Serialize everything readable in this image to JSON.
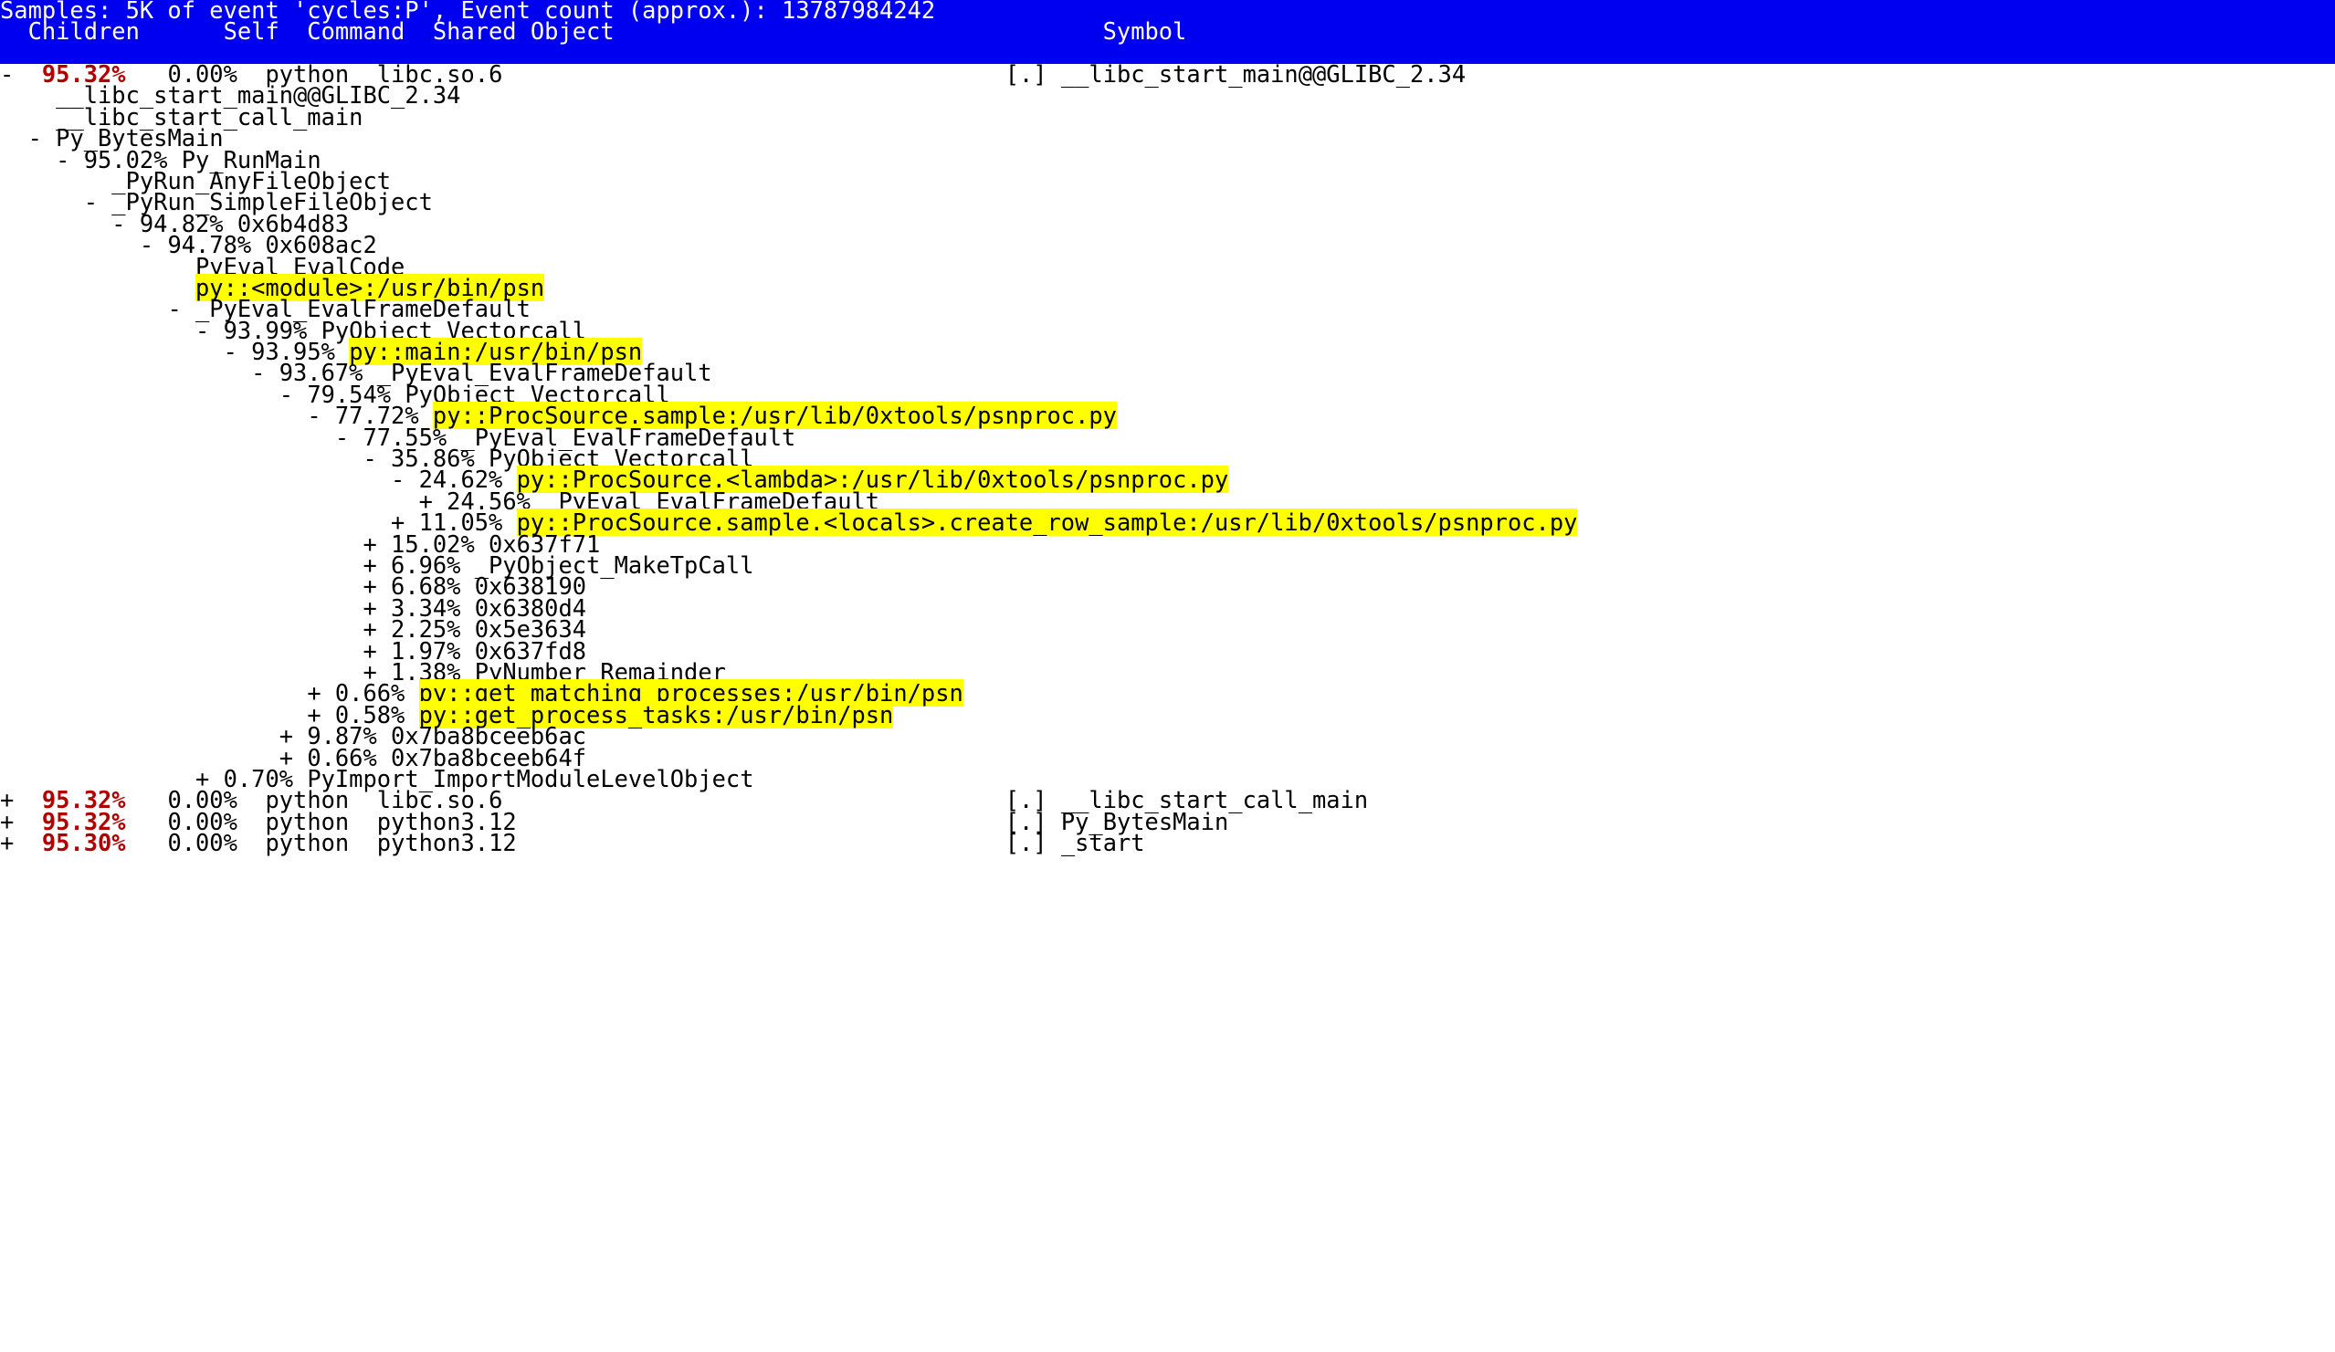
{
  "window": {
    "app": "perf report",
    "colors": {
      "banner_bg": "#0000f0",
      "banner_fg": "#ffffff",
      "percent_children": "#b00000",
      "highlight_bg": "#ffff00",
      "text": "#000000",
      "background": "#ffffff"
    }
  },
  "banner": {
    "samples_line": "Samples: 5K of event 'cycles:P', Event count (approx.): 13787984242",
    "columns": {
      "children": "Children",
      "self": "Self",
      "command": "Command",
      "shared_object": "Shared Object",
      "symbol": "Symbol"
    },
    "columns_line": "  Children      Self  Command  Shared Object                                   Symbol"
  },
  "rows": [
    {
      "type": "entry",
      "marker": "-",
      "children": "95.32%",
      "self": "0.00%",
      "command": "python",
      "dso": "libc.so.6",
      "symbol_prefix": "[.] ",
      "symbol": "__libc_start_main@@GLIBC_2.34"
    },
    {
      "type": "call",
      "indent": 4,
      "marker": "",
      "pct": "",
      "label": "__libc_start_main@@GLIBC_2.34",
      "highlight": false
    },
    {
      "type": "call",
      "indent": 4,
      "marker": "",
      "pct": "",
      "label": "__libc_start_call_main",
      "highlight": false
    },
    {
      "type": "call",
      "indent": 2,
      "marker": "-",
      "pct": "",
      "label": "Py_BytesMain",
      "highlight": false
    },
    {
      "type": "call",
      "indent": 4,
      "marker": "-",
      "pct": "95.02%",
      "label": "Py_RunMain",
      "highlight": false
    },
    {
      "type": "call",
      "indent": 8,
      "marker": "",
      "pct": "",
      "label": "_PyRun_AnyFileObject",
      "highlight": false
    },
    {
      "type": "call",
      "indent": 6,
      "marker": "-",
      "pct": "",
      "label": "_PyRun_SimpleFileObject",
      "highlight": false
    },
    {
      "type": "call",
      "indent": 8,
      "marker": "-",
      "pct": "94.82%",
      "label": "0x6b4d83",
      "highlight": false
    },
    {
      "type": "call",
      "indent": 10,
      "marker": "-",
      "pct": "94.78%",
      "label": "0x608ac2",
      "highlight": false
    },
    {
      "type": "call",
      "indent": 14,
      "marker": "",
      "pct": "",
      "label": "PyEval_EvalCode",
      "highlight": false
    },
    {
      "type": "call",
      "indent": 14,
      "marker": "",
      "pct": "",
      "label": "py::<module>:/usr/bin/psn",
      "highlight": true
    },
    {
      "type": "call",
      "indent": 12,
      "marker": "-",
      "pct": "",
      "label": "_PyEval_EvalFrameDefault",
      "highlight": false
    },
    {
      "type": "call",
      "indent": 14,
      "marker": "-",
      "pct": "93.99%",
      "label": "PyObject_Vectorcall",
      "highlight": false
    },
    {
      "type": "call",
      "indent": 16,
      "marker": "-",
      "pct": "93.95%",
      "label": "py::main:/usr/bin/psn",
      "highlight": true
    },
    {
      "type": "call",
      "indent": 18,
      "marker": "-",
      "pct": "93.67%",
      "label": "_PyEval_EvalFrameDefault",
      "highlight": false
    },
    {
      "type": "call",
      "indent": 20,
      "marker": "-",
      "pct": "79.54%",
      "label": "PyObject_Vectorcall",
      "highlight": false
    },
    {
      "type": "call",
      "indent": 22,
      "marker": "-",
      "pct": "77.72%",
      "label": "py::ProcSource.sample:/usr/lib/0xtools/psnproc.py",
      "highlight": true
    },
    {
      "type": "call",
      "indent": 24,
      "marker": "-",
      "pct": "77.55%",
      "label": "_PyEval_EvalFrameDefault",
      "highlight": false
    },
    {
      "type": "call",
      "indent": 26,
      "marker": "-",
      "pct": "35.86%",
      "label": "PyObject_Vectorcall",
      "highlight": false
    },
    {
      "type": "call",
      "indent": 28,
      "marker": "-",
      "pct": "24.62%",
      "label": "py::ProcSource.<lambda>:/usr/lib/0xtools/psnproc.py",
      "highlight": true
    },
    {
      "type": "call",
      "indent": 30,
      "marker": "+",
      "pct": "24.56%",
      "label": "_PyEval_EvalFrameDefault",
      "highlight": false
    },
    {
      "type": "call",
      "indent": 28,
      "marker": "+",
      "pct": "11.05%",
      "label": "py::ProcSource.sample.<locals>.create_row_sample:/usr/lib/0xtools/psnproc.py",
      "highlight": true
    },
    {
      "type": "call",
      "indent": 26,
      "marker": "+",
      "pct": "15.02%",
      "label": "0x637f71",
      "highlight": false
    },
    {
      "type": "call",
      "indent": 26,
      "marker": "+",
      "pct": "6.96%",
      "label": "_PyObject_MakeTpCall",
      "highlight": false
    },
    {
      "type": "call",
      "indent": 26,
      "marker": "+",
      "pct": "6.68%",
      "label": "0x638190",
      "highlight": false
    },
    {
      "type": "call",
      "indent": 26,
      "marker": "+",
      "pct": "3.34%",
      "label": "0x6380d4",
      "highlight": false
    },
    {
      "type": "call",
      "indent": 26,
      "marker": "+",
      "pct": "2.25%",
      "label": "0x5e3634",
      "highlight": false
    },
    {
      "type": "call",
      "indent": 26,
      "marker": "+",
      "pct": "1.97%",
      "label": "0x637fd8",
      "highlight": false
    },
    {
      "type": "call",
      "indent": 26,
      "marker": "+",
      "pct": "1.38%",
      "label": "PyNumber_Remainder",
      "highlight": false
    },
    {
      "type": "call",
      "indent": 22,
      "marker": "+",
      "pct": "0.66%",
      "label": "py::get_matching_processes:/usr/bin/psn",
      "highlight": true
    },
    {
      "type": "call",
      "indent": 22,
      "marker": "+",
      "pct": "0.58%",
      "label": "py::get_process_tasks:/usr/bin/psn",
      "highlight": true
    },
    {
      "type": "call",
      "indent": 20,
      "marker": "+",
      "pct": "9.87%",
      "label": "0x7ba8bceeb6ac",
      "highlight": false
    },
    {
      "type": "call",
      "indent": 20,
      "marker": "+",
      "pct": "0.66%",
      "label": "0x7ba8bceeb64f",
      "highlight": false
    },
    {
      "type": "call",
      "indent": 14,
      "marker": "+",
      "pct": "0.70%",
      "label": "PyImport_ImportModuleLevelObject",
      "highlight": false
    },
    {
      "type": "entry",
      "marker": "+",
      "children": "95.32%",
      "self": "0.00%",
      "command": "python",
      "dso": "libc.so.6",
      "symbol_prefix": "[.] ",
      "symbol": "__libc_start_call_main"
    },
    {
      "type": "entry",
      "marker": "+",
      "children": "95.32%",
      "self": "0.00%",
      "command": "python",
      "dso": "python3.12",
      "symbol_prefix": "[.] ",
      "symbol": "Py_BytesMain"
    },
    {
      "type": "entry",
      "marker": "+",
      "children": "95.30%",
      "self": "0.00%",
      "command": "python",
      "dso": "python3.12",
      "symbol_prefix": "[.] ",
      "symbol": "_start"
    }
  ]
}
